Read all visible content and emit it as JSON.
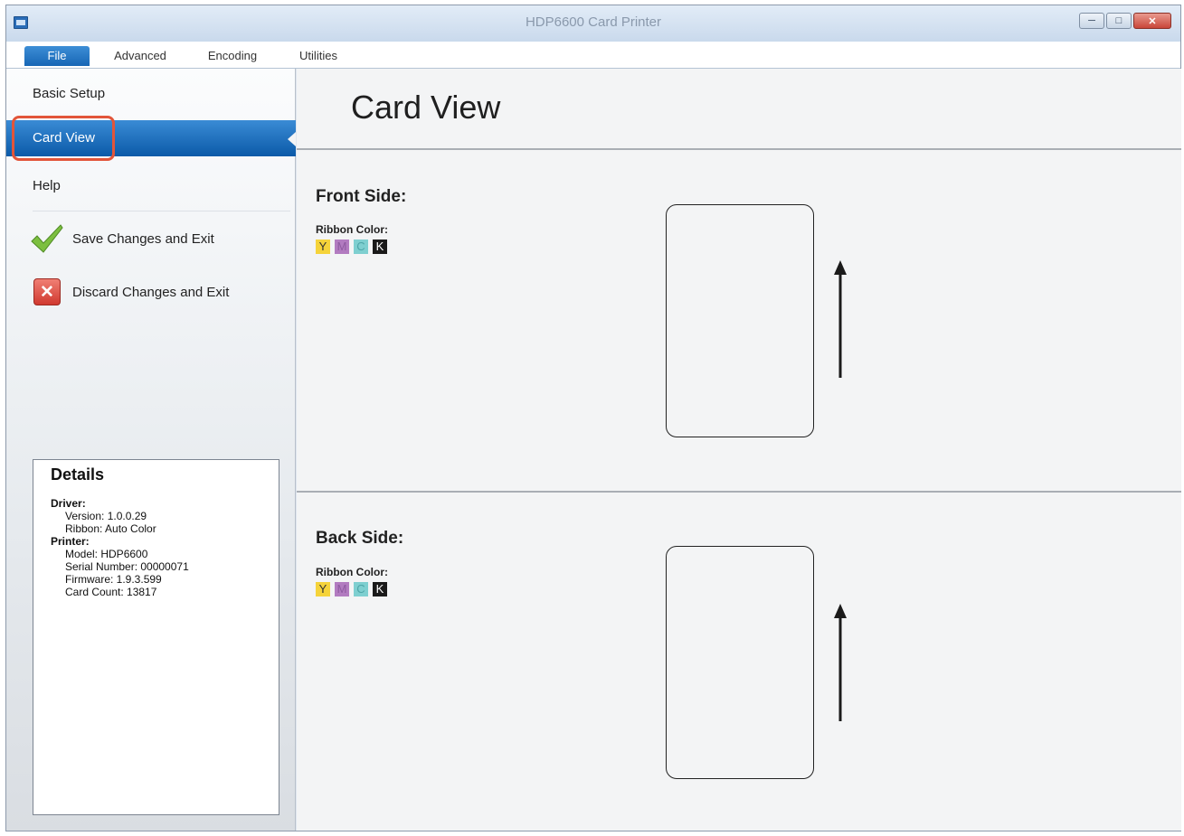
{
  "window": {
    "title": "HDP6600 Card Printer"
  },
  "tabs": [
    {
      "label": "File",
      "active": true
    },
    {
      "label": "Advanced",
      "active": false
    },
    {
      "label": "Encoding",
      "active": false
    },
    {
      "label": "Utilities",
      "active": false
    }
  ],
  "sidebar": {
    "items": [
      {
        "label": "Basic Setup",
        "selected": false
      },
      {
        "label": "Card View",
        "selected": true
      },
      {
        "label": "Help",
        "selected": false
      }
    ],
    "actions": {
      "save": {
        "label": "Save Changes and Exit",
        "icon": "checkmark-icon"
      },
      "discard": {
        "label": "Discard Changes and Exit",
        "icon": "close-icon"
      }
    }
  },
  "details": {
    "title": "Details",
    "driver_label": "Driver:",
    "driver_version": "Version: 1.0.0.29",
    "driver_ribbon": "Ribbon: Auto Color",
    "printer_label": "Printer:",
    "printer_model": "Model: HDP6600",
    "printer_serial": "Serial Number: 00000071",
    "printer_firmware": "Firmware: 1.9.3.599",
    "printer_card_count": "Card Count: 13817"
  },
  "main": {
    "title": "Card View",
    "front": {
      "title": "Front Side:",
      "ribbon_label": "Ribbon Color:",
      "panels": [
        "Y",
        "M",
        "C",
        "K"
      ]
    },
    "back": {
      "title": "Back Side:",
      "ribbon_label": "Ribbon Color:",
      "panels": [
        "Y",
        "M",
        "C",
        "K"
      ]
    }
  },
  "colors": {
    "accent": "#1766b5",
    "highlight": "#e2553a",
    "panel_y": "#f5d33a",
    "panel_m": "#b27bc0",
    "panel_c": "#7ecfd0",
    "panel_k": "#1a1a1a"
  }
}
